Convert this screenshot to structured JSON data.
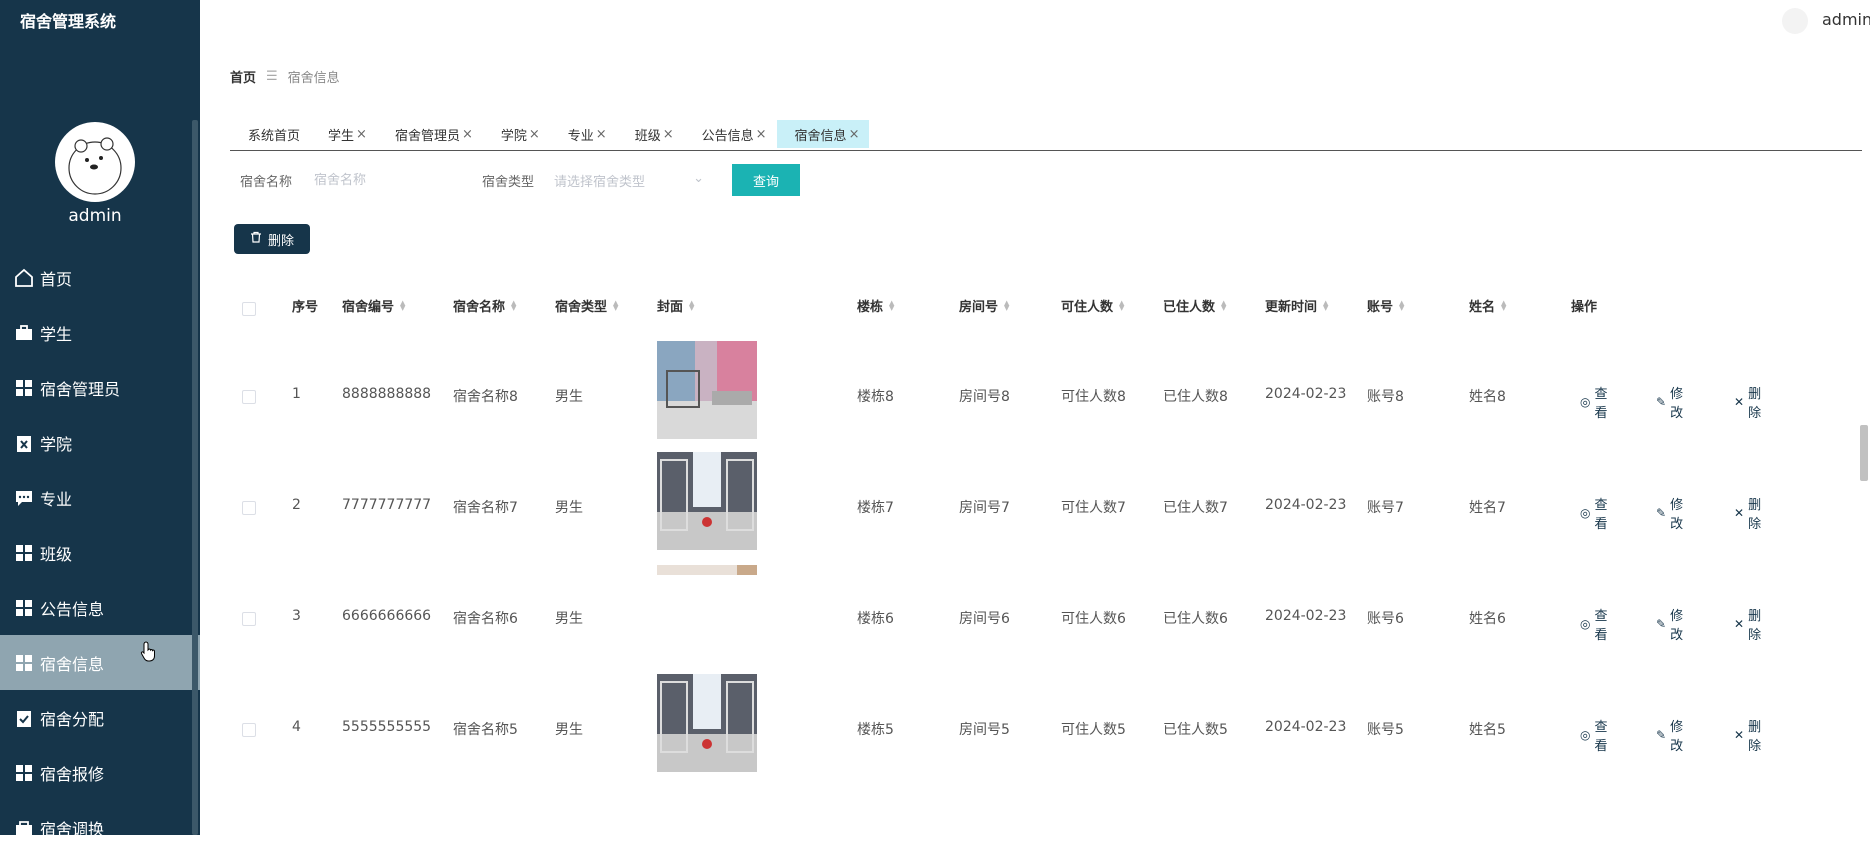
{
  "app": {
    "title": "宿舍管理系统"
  },
  "user": {
    "name": "admin"
  },
  "sidebar": {
    "items": [
      {
        "label": "首页",
        "icon": "home-icon",
        "active": false
      },
      {
        "label": "学生",
        "icon": "briefcase-icon",
        "active": false
      },
      {
        "label": "宿舍管理员",
        "icon": "grid-icon",
        "active": false
      },
      {
        "label": "学院",
        "icon": "clipboard-x-icon",
        "active": false
      },
      {
        "label": "专业",
        "icon": "chat-icon",
        "active": false
      },
      {
        "label": "班级",
        "icon": "grid-icon",
        "active": false
      },
      {
        "label": "公告信息",
        "icon": "grid-icon",
        "active": false
      },
      {
        "label": "宿舍信息",
        "icon": "grid-icon",
        "active": true
      },
      {
        "label": "宿舍分配",
        "icon": "clipboard-check-icon",
        "active": false
      },
      {
        "label": "宿舍报修",
        "icon": "grid-icon",
        "active": false
      },
      {
        "label": "宿舍调换",
        "icon": "bag-icon",
        "active": false
      }
    ]
  },
  "breadcrumb": {
    "home": "首页",
    "current": "宿舍信息"
  },
  "tabs": [
    {
      "label": "系统首页",
      "closable": false,
      "active": false
    },
    {
      "label": "学生",
      "closable": true,
      "active": false
    },
    {
      "label": "宿舍管理员",
      "closable": true,
      "active": false
    },
    {
      "label": "学院",
      "closable": true,
      "active": false
    },
    {
      "label": "专业",
      "closable": true,
      "active": false
    },
    {
      "label": "班级",
      "closable": true,
      "active": false
    },
    {
      "label": "公告信息",
      "closable": true,
      "active": false
    },
    {
      "label": "宿舍信息",
      "closable": true,
      "active": true
    }
  ],
  "search": {
    "name_label": "宿舍名称",
    "name_placeholder": "宿舍名称",
    "type_label": "宿舍类型",
    "type_placeholder": "请选择宿舍类型",
    "query_label": "查询"
  },
  "toolbar": {
    "delete_label": "删除"
  },
  "table": {
    "columns": [
      "序号",
      "宿舍编号",
      "宿舍名称",
      "宿舍类型",
      "封面",
      "楼栋",
      "房间号",
      "可住人数",
      "已住人数",
      "更新时间",
      "账号",
      "姓名",
      "操作"
    ],
    "rows": [
      {
        "index": "1",
        "code": "8888888888",
        "name": "宿舍名称8",
        "type": "男生",
        "building": "楼栋8",
        "room": "房间号8",
        "capacity": "可住人数8",
        "occupied": "已住人数8",
        "updated": "2024-02-23",
        "account": "账号8",
        "person": "姓名8"
      },
      {
        "index": "2",
        "code": "7777777777",
        "name": "宿舍名称7",
        "type": "男生",
        "building": "楼栋7",
        "room": "房间号7",
        "capacity": "可住人数7",
        "occupied": "已住人数7",
        "updated": "2024-02-23",
        "account": "账号7",
        "person": "姓名7"
      },
      {
        "index": "3",
        "code": "6666666666",
        "name": "宿舍名称6",
        "type": "男生",
        "building": "楼栋6",
        "room": "房间号6",
        "capacity": "可住人数6",
        "occupied": "已住人数6",
        "updated": "2024-02-23",
        "account": "账号6",
        "person": "姓名6"
      },
      {
        "index": "4",
        "code": "5555555555",
        "name": "宿舍名称5",
        "type": "男生",
        "building": "楼栋5",
        "room": "房间号5",
        "capacity": "可住人数5",
        "occupied": "已住人数5",
        "updated": "2024-02-23",
        "account": "账号5",
        "person": "姓名5"
      }
    ],
    "actions": {
      "view": "查看",
      "edit": "修改",
      "delete": "删除"
    }
  }
}
